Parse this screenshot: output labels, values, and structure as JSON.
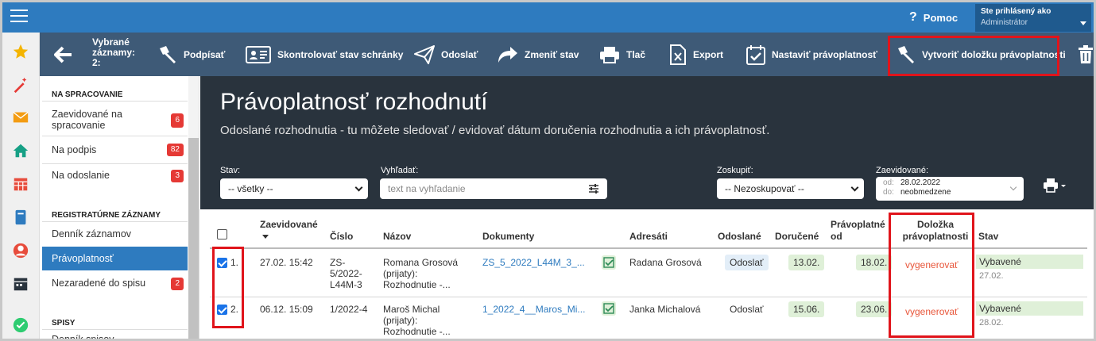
{
  "topbar": {
    "help_label": "Pomoc",
    "user_label": "Ste prihlásený ako",
    "user_name": "Administrátor"
  },
  "toolbar": {
    "selected_label": "Vybrané záznamy:",
    "selected_count": "2:",
    "sign": "Podpísať",
    "check_mailbox": "Skontrolovať stav schránky",
    "send": "Odoslať",
    "change_state": "Zmeniť stav",
    "print": "Tlač",
    "export": "Export",
    "set_validity": "Nastaviť právoplatnosť",
    "create_clause": "Vytvoriť doložku právoplatnosti"
  },
  "sidebar": {
    "section1": "NA SPRACOVANIE",
    "items1": [
      {
        "label": "Zaevidované na spracovanie",
        "count": "6"
      },
      {
        "label": "Na podpis",
        "count": "82"
      },
      {
        "label": "Na odoslanie",
        "count": "3"
      }
    ],
    "section2": "REGISTRATÚRNE ZÁZNAMY",
    "items2": [
      {
        "label": "Denník záznamov"
      },
      {
        "label": "Právoplatnosť"
      },
      {
        "label": "Nezaradené do spisu",
        "count": "2"
      }
    ],
    "section3": "SPISY",
    "items3": [
      {
        "label": "Denník spisov"
      }
    ]
  },
  "main": {
    "title": "Právoplatnosť rozhodnutí",
    "subtitle": "Odoslané rozhodnutia - tu môžete sledovať / evidovať dátum doručenia rozhodnutia a ich právoplatnosť."
  },
  "filters": {
    "stav_label": "Stav:",
    "stav_value": "-- všetky --",
    "search_label": "Vyhľadať:",
    "search_placeholder": "text na vyhľadanie",
    "group_label": "Zoskupiť:",
    "group_value": "-- Nezoskupovať --",
    "registered_label": "Zaevidované:",
    "from_key": "od:",
    "from_value": "28.02.2022",
    "to_key": "do:",
    "to_value": "neobmedzene"
  },
  "table": {
    "headers": {
      "registered": "Zaevidované",
      "number": "Číslo",
      "name": "Názov",
      "documents": "Dokumenty",
      "recipients": "Adresáti",
      "sent": "Odoslané",
      "delivered": "Doručené",
      "valid_from_1": "Právoplatné",
      "valid_from_2": "od",
      "clause_1": "Doložka",
      "clause_2": "právoplatnosti",
      "state": "Stav"
    },
    "rows": [
      {
        "index": "1.",
        "registered": "27.02. 15:42",
        "number_1": "ZS-",
        "number_2": "5/2022-",
        "number_3": "L44M-3",
        "name_1": "Romana Grosová",
        "name_2": "(prijaty):",
        "name_3": "Rozhodnutie -...",
        "document": "ZS_5_2022_L44M_3_...",
        "recipient": "Radana Grosová",
        "sent": "Odoslať",
        "delivered": "13.02.",
        "valid_from": "18.02.",
        "clause": "vygenerovať",
        "state": "Vybavené",
        "state_date": "27.02."
      },
      {
        "index": "2.",
        "registered": "06.12. 15:09",
        "number_1": "1/2022-4",
        "number_2": "",
        "number_3": "",
        "name_1": "Maroš Michal",
        "name_2": "(prijaty):",
        "name_3": "Rozhodnutie -...",
        "document": "1_2022_4__Maros_Mi...",
        "recipient": "Janka Michalová",
        "sent": "Odoslať",
        "delivered": "15.06.",
        "valid_from": "23.06.",
        "clause": "vygenerovať",
        "state": "Vybavené",
        "state_date": "28.02."
      }
    ]
  },
  "colors": {
    "topbar": "#2e7bbf",
    "toolbar": "#3e5a77",
    "header": "#29333d",
    "highlight": "#e0141b",
    "badge": "#e53935",
    "link_orange": "#e8563a"
  }
}
